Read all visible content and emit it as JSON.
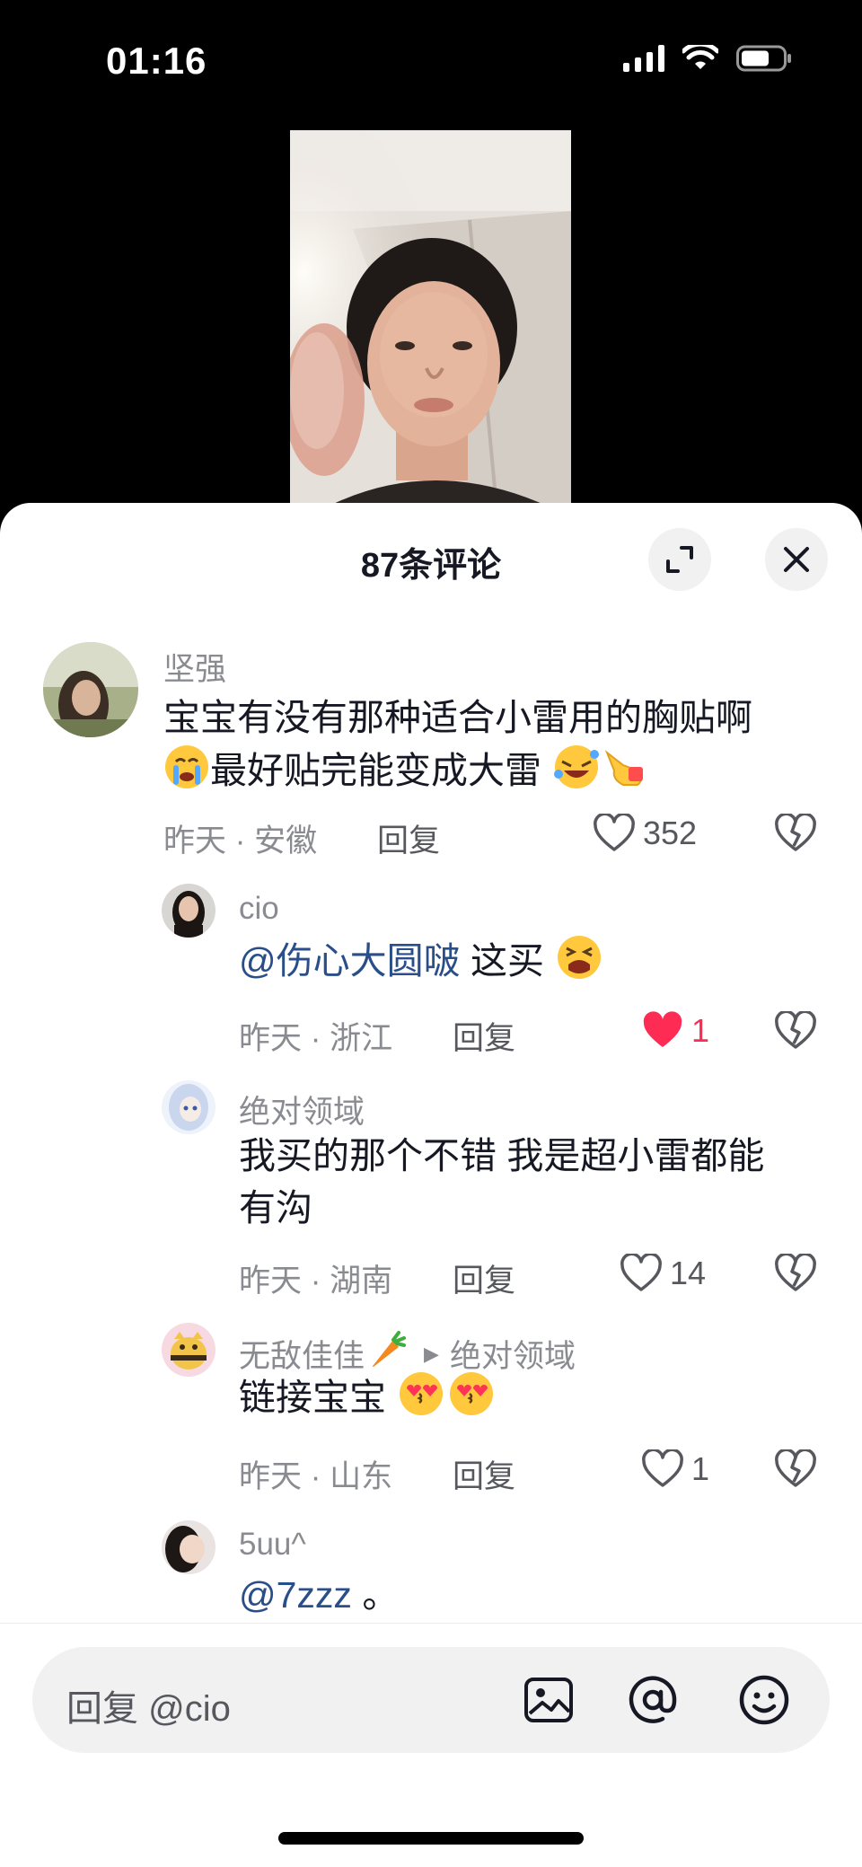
{
  "status": {
    "time": "01:16"
  },
  "sheet": {
    "title": "87条评论"
  },
  "comments": [
    {
      "name": "坚强",
      "text_line1": "宝宝有没有那种适合小雷用的胸贴啊",
      "text_line2": "最好贴完能变成大雷",
      "time": "昨天 · 安徽",
      "reply": "回复",
      "likes": "352",
      "liked": false
    },
    {
      "name": "cio",
      "mention": "@伤心大圆啵",
      "text": "这买",
      "time": "昨天 · 浙江",
      "reply": "回复",
      "likes": "1",
      "liked": true
    },
    {
      "name": "绝对领域",
      "text_line1": "我买的那个不错 我是超小雷都能",
      "text_line2": "有沟",
      "time": "昨天 · 湖南",
      "reply": "回复",
      "likes": "14",
      "liked": false
    },
    {
      "name": "无敌佳佳",
      "reply_to": "绝对领域",
      "text": "链接宝宝",
      "time": "昨天 · 山东",
      "reply": "回复",
      "likes": "1",
      "liked": false
    },
    {
      "name": "5uu^",
      "mention": "@7zzz",
      "text": "。"
    }
  ],
  "input": {
    "placeholder": "回复 @cio"
  },
  "icons": {
    "expand": "expand-icon",
    "close": "close-icon",
    "heart": "heart-icon",
    "broken_heart": "broken-heart-icon",
    "image": "image-icon",
    "at": "at-icon",
    "emoji": "emoji-icon"
  },
  "colors": {
    "like_active": "#fe2c55",
    "mention": "#2a4e8a",
    "secondary_text": "#8a8b91"
  }
}
